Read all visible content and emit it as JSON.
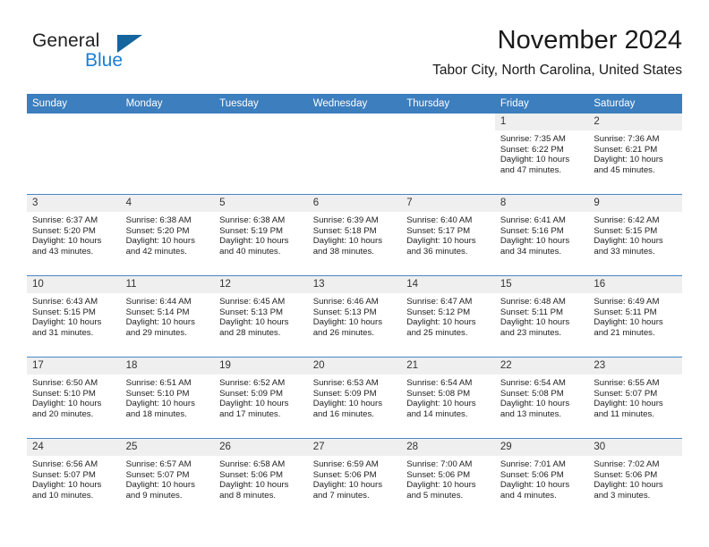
{
  "brand": {
    "name_part1": "General",
    "name_part2": "Blue"
  },
  "header": {
    "month_title": "November 2024",
    "location": "Tabor City, North Carolina, United States"
  },
  "colors": {
    "header_blue": "#3c7ebe",
    "row_divider_blue": "#4a86c5",
    "daynum_band": "#efefef",
    "logo_blue": "#1b7fd4",
    "logo_triangle": "#14659e"
  },
  "weekday_headers": [
    "Sunday",
    "Monday",
    "Tuesday",
    "Wednesday",
    "Thursday",
    "Friday",
    "Saturday"
  ],
  "weeks": [
    [
      {
        "day": "",
        "sunrise": "",
        "sunset": "",
        "daylight": "",
        "empty": true
      },
      {
        "day": "",
        "sunrise": "",
        "sunset": "",
        "daylight": "",
        "empty": true
      },
      {
        "day": "",
        "sunrise": "",
        "sunset": "",
        "daylight": "",
        "empty": true
      },
      {
        "day": "",
        "sunrise": "",
        "sunset": "",
        "daylight": "",
        "empty": true
      },
      {
        "day": "",
        "sunrise": "",
        "sunset": "",
        "daylight": "",
        "empty": true
      },
      {
        "day": "1",
        "sunrise": "Sunrise: 7:35 AM",
        "sunset": "Sunset: 6:22 PM",
        "daylight": "Daylight: 10 hours and 47 minutes.",
        "empty": false
      },
      {
        "day": "2",
        "sunrise": "Sunrise: 7:36 AM",
        "sunset": "Sunset: 6:21 PM",
        "daylight": "Daylight: 10 hours and 45 minutes.",
        "empty": false
      }
    ],
    [
      {
        "day": "3",
        "sunrise": "Sunrise: 6:37 AM",
        "sunset": "Sunset: 5:20 PM",
        "daylight": "Daylight: 10 hours and 43 minutes.",
        "empty": false
      },
      {
        "day": "4",
        "sunrise": "Sunrise: 6:38 AM",
        "sunset": "Sunset: 5:20 PM",
        "daylight": "Daylight: 10 hours and 42 minutes.",
        "empty": false
      },
      {
        "day": "5",
        "sunrise": "Sunrise: 6:38 AM",
        "sunset": "Sunset: 5:19 PM",
        "daylight": "Daylight: 10 hours and 40 minutes.",
        "empty": false
      },
      {
        "day": "6",
        "sunrise": "Sunrise: 6:39 AM",
        "sunset": "Sunset: 5:18 PM",
        "daylight": "Daylight: 10 hours and 38 minutes.",
        "empty": false
      },
      {
        "day": "7",
        "sunrise": "Sunrise: 6:40 AM",
        "sunset": "Sunset: 5:17 PM",
        "daylight": "Daylight: 10 hours and 36 minutes.",
        "empty": false
      },
      {
        "day": "8",
        "sunrise": "Sunrise: 6:41 AM",
        "sunset": "Sunset: 5:16 PM",
        "daylight": "Daylight: 10 hours and 34 minutes.",
        "empty": false
      },
      {
        "day": "9",
        "sunrise": "Sunrise: 6:42 AM",
        "sunset": "Sunset: 5:15 PM",
        "daylight": "Daylight: 10 hours and 33 minutes.",
        "empty": false
      }
    ],
    [
      {
        "day": "10",
        "sunrise": "Sunrise: 6:43 AM",
        "sunset": "Sunset: 5:15 PM",
        "daylight": "Daylight: 10 hours and 31 minutes.",
        "empty": false
      },
      {
        "day": "11",
        "sunrise": "Sunrise: 6:44 AM",
        "sunset": "Sunset: 5:14 PM",
        "daylight": "Daylight: 10 hours and 29 minutes.",
        "empty": false
      },
      {
        "day": "12",
        "sunrise": "Sunrise: 6:45 AM",
        "sunset": "Sunset: 5:13 PM",
        "daylight": "Daylight: 10 hours and 28 minutes.",
        "empty": false
      },
      {
        "day": "13",
        "sunrise": "Sunrise: 6:46 AM",
        "sunset": "Sunset: 5:13 PM",
        "daylight": "Daylight: 10 hours and 26 minutes.",
        "empty": false
      },
      {
        "day": "14",
        "sunrise": "Sunrise: 6:47 AM",
        "sunset": "Sunset: 5:12 PM",
        "daylight": "Daylight: 10 hours and 25 minutes.",
        "empty": false
      },
      {
        "day": "15",
        "sunrise": "Sunrise: 6:48 AM",
        "sunset": "Sunset: 5:11 PM",
        "daylight": "Daylight: 10 hours and 23 minutes.",
        "empty": false
      },
      {
        "day": "16",
        "sunrise": "Sunrise: 6:49 AM",
        "sunset": "Sunset: 5:11 PM",
        "daylight": "Daylight: 10 hours and 21 minutes.",
        "empty": false
      }
    ],
    [
      {
        "day": "17",
        "sunrise": "Sunrise: 6:50 AM",
        "sunset": "Sunset: 5:10 PM",
        "daylight": "Daylight: 10 hours and 20 minutes.",
        "empty": false
      },
      {
        "day": "18",
        "sunrise": "Sunrise: 6:51 AM",
        "sunset": "Sunset: 5:10 PM",
        "daylight": "Daylight: 10 hours and 18 minutes.",
        "empty": false
      },
      {
        "day": "19",
        "sunrise": "Sunrise: 6:52 AM",
        "sunset": "Sunset: 5:09 PM",
        "daylight": "Daylight: 10 hours and 17 minutes.",
        "empty": false
      },
      {
        "day": "20",
        "sunrise": "Sunrise: 6:53 AM",
        "sunset": "Sunset: 5:09 PM",
        "daylight": "Daylight: 10 hours and 16 minutes.",
        "empty": false
      },
      {
        "day": "21",
        "sunrise": "Sunrise: 6:54 AM",
        "sunset": "Sunset: 5:08 PM",
        "daylight": "Daylight: 10 hours and 14 minutes.",
        "empty": false
      },
      {
        "day": "22",
        "sunrise": "Sunrise: 6:54 AM",
        "sunset": "Sunset: 5:08 PM",
        "daylight": "Daylight: 10 hours and 13 minutes.",
        "empty": false
      },
      {
        "day": "23",
        "sunrise": "Sunrise: 6:55 AM",
        "sunset": "Sunset: 5:07 PM",
        "daylight": "Daylight: 10 hours and 11 minutes.",
        "empty": false
      }
    ],
    [
      {
        "day": "24",
        "sunrise": "Sunrise: 6:56 AM",
        "sunset": "Sunset: 5:07 PM",
        "daylight": "Daylight: 10 hours and 10 minutes.",
        "empty": false
      },
      {
        "day": "25",
        "sunrise": "Sunrise: 6:57 AM",
        "sunset": "Sunset: 5:07 PM",
        "daylight": "Daylight: 10 hours and 9 minutes.",
        "empty": false
      },
      {
        "day": "26",
        "sunrise": "Sunrise: 6:58 AM",
        "sunset": "Sunset: 5:06 PM",
        "daylight": "Daylight: 10 hours and 8 minutes.",
        "empty": false
      },
      {
        "day": "27",
        "sunrise": "Sunrise: 6:59 AM",
        "sunset": "Sunset: 5:06 PM",
        "daylight": "Daylight: 10 hours and 7 minutes.",
        "empty": false
      },
      {
        "day": "28",
        "sunrise": "Sunrise: 7:00 AM",
        "sunset": "Sunset: 5:06 PM",
        "daylight": "Daylight: 10 hours and 5 minutes.",
        "empty": false
      },
      {
        "day": "29",
        "sunrise": "Sunrise: 7:01 AM",
        "sunset": "Sunset: 5:06 PM",
        "daylight": "Daylight: 10 hours and 4 minutes.",
        "empty": false
      },
      {
        "day": "30",
        "sunrise": "Sunrise: 7:02 AM",
        "sunset": "Sunset: 5:06 PM",
        "daylight": "Daylight: 10 hours and 3 minutes.",
        "empty": false
      }
    ]
  ]
}
